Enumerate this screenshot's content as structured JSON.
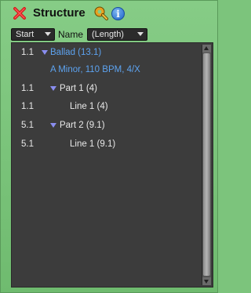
{
  "window": {
    "title": "Structure"
  },
  "icons": {
    "close": "close-icon",
    "wrench": "wrench-icon",
    "info": "info-icon"
  },
  "toolbar": {
    "start_dropdown": "Start",
    "name_label": "Name",
    "length_dropdown": "(Length)"
  },
  "rows": [
    {
      "position": "1.1",
      "label": "Ballad (13.1)",
      "expanded": true
    },
    {
      "position": "",
      "label": "A Minor, 110 BPM, 4/X"
    },
    {
      "position": "1.1",
      "label": "Part 1 (4)",
      "expanded": true
    },
    {
      "position": "1.1",
      "label": "Line 1 (4)"
    },
    {
      "position": "5.1",
      "label": "Part 2 (9.1)",
      "expanded": true
    },
    {
      "position": "5.1",
      "label": "Line 1 (9.1)"
    }
  ],
  "colors": {
    "accent_blue": "#5da3f0",
    "panel_green": "#7cc47c",
    "list_bg": "#3c3c3c",
    "disclosure": "#8a8ef0"
  }
}
